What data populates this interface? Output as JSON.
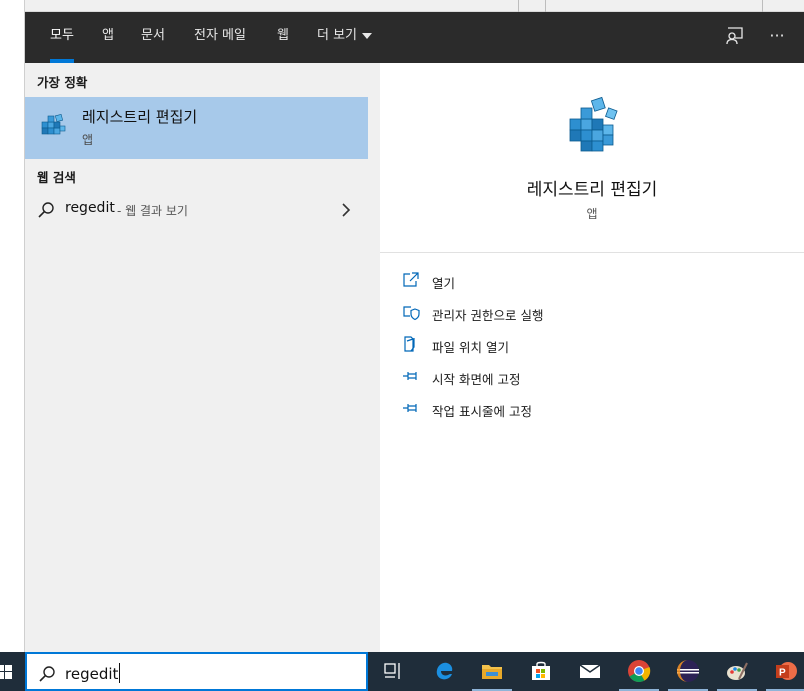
{
  "tabs": [
    {
      "label": "모두",
      "active": true
    },
    {
      "label": "앱"
    },
    {
      "label": "문서"
    },
    {
      "label": "전자 메일"
    },
    {
      "label": "웹"
    },
    {
      "label": "더 보기"
    }
  ],
  "header_icons": [
    "feedback-icon",
    "more-options-icon"
  ],
  "header_more_label": "···",
  "best_match": {
    "heading": "가장 정확",
    "title": "레지스트리 편집기",
    "subtitle": "앱",
    "icon": "registry-editor-icon"
  },
  "web_search": {
    "heading": "웹 검색",
    "query": "regedit",
    "hint": "- 웹 결과 보기",
    "icon": "search-icon"
  },
  "preview": {
    "title": "레지스트리 편집기",
    "subtitle": "앱",
    "icon": "registry-editor-icon"
  },
  "actions": [
    {
      "label": "열기",
      "icon": "open-icon"
    },
    {
      "label": "관리자 권한으로 실행",
      "icon": "run-as-admin-icon"
    },
    {
      "label": "파일 위치 열기",
      "icon": "file-location-icon"
    },
    {
      "label": "시작 화면에 고정",
      "icon": "pin-icon"
    },
    {
      "label": "작업 표시줄에 고정",
      "icon": "pin-icon"
    }
  ],
  "search_box": {
    "value": "regedit",
    "icon": "search-icon"
  },
  "taskbar": [
    {
      "name": "task-view-icon"
    },
    {
      "name": "edge-icon"
    },
    {
      "name": "file-explorer-icon"
    },
    {
      "name": "store-icon"
    },
    {
      "name": "mail-icon"
    },
    {
      "name": "chrome-icon"
    },
    {
      "name": "eclipse-icon"
    },
    {
      "name": "paint-icon"
    },
    {
      "name": "powerpoint-icon"
    }
  ],
  "colors": {
    "accent": "#0078d7",
    "tab_bar": "#2b2b2b",
    "selection": "#a7c9ea",
    "taskbar": "#1f2d3a"
  }
}
